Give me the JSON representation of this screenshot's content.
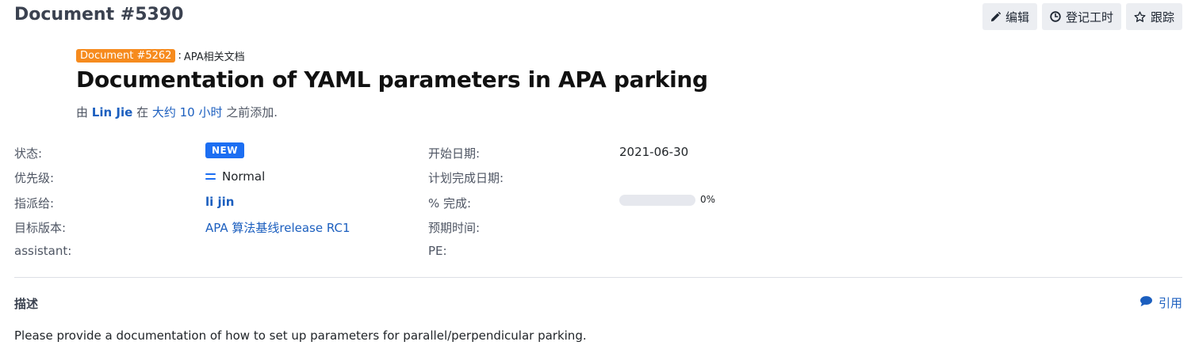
{
  "header": {
    "doc_title": "Document #5390",
    "actions": {
      "edit": "编辑",
      "log_time": "登记工时",
      "watch": "跟踪"
    }
  },
  "parent": {
    "badge": "Document #5262",
    "separator": ":",
    "title": "APA相关文档"
  },
  "issue": {
    "subject": "Documentation of YAML parameters in APA parking",
    "author_prefix": "由",
    "author": "Lin Jie",
    "author_mid": "在",
    "time_ago": "大约 10 小时",
    "author_suffix": "之前添加."
  },
  "attributes": {
    "left": {
      "status_label": "状态:",
      "status_value": "NEW",
      "priority_label": "优先级:",
      "priority_value": "Normal",
      "assignee_label": "指派给:",
      "assignee_value": "li jin",
      "version_label": "目标版本:",
      "version_value": "APA 算法基线release RC1",
      "assistant_label": "assistant:"
    },
    "right": {
      "start_label": "开始日期:",
      "start_value": "2021-06-30",
      "due_label": "计划完成日期:",
      "done_label": "% 完成:",
      "done_percent": 0,
      "done_text": "0%",
      "estimated_label": "预期时间:",
      "pe_label": "PE:"
    }
  },
  "description": {
    "heading": "描述",
    "quote_label": "引用",
    "text": "Please provide a documentation of how to set up parameters for parallel/perpendicular parking."
  },
  "colors": {
    "accent": "#1c6ef2",
    "link": "#1c5fbf",
    "parent_badge": "#f68b1e"
  },
  "icons": {
    "edit": "pencil-icon",
    "log_time": "clock-icon",
    "watch": "star-icon",
    "priority": "equals-icon",
    "quote": "speech-bubble-icon"
  }
}
